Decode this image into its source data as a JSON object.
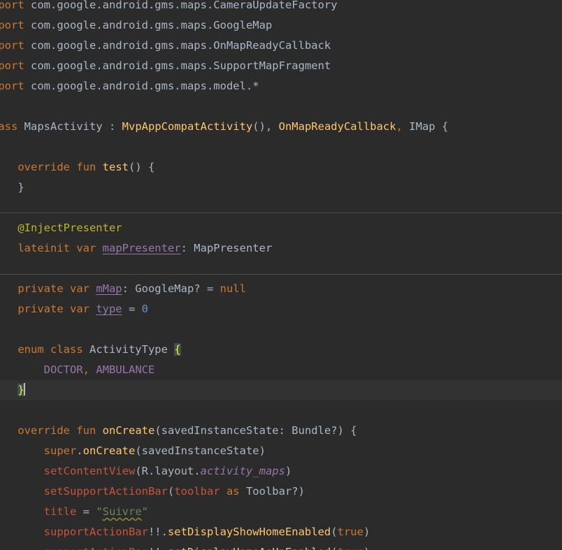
{
  "lines": [
    {
      "tokens": [
        {
          "t": "kw",
          "v": "nport"
        },
        {
          "t": "plain",
          "v": " com.google.android.gms.maps.CameraUpdateFactory"
        }
      ]
    },
    {
      "tokens": [
        {
          "t": "kw",
          "v": "nport"
        },
        {
          "t": "plain",
          "v": " com.google.android.gms.maps.GoogleMap"
        }
      ]
    },
    {
      "tokens": [
        {
          "t": "kw",
          "v": "nport"
        },
        {
          "t": "plain",
          "v": " com.google.android.gms.maps.OnMapReadyCallback"
        }
      ]
    },
    {
      "tokens": [
        {
          "t": "kw",
          "v": "nport"
        },
        {
          "t": "plain",
          "v": " com.google.android.gms.maps.SupportMapFragment"
        }
      ]
    },
    {
      "tokens": [
        {
          "t": "kw",
          "v": "nport"
        },
        {
          "t": "plain",
          "v": " com.google.android.gms.maps.model.*"
        }
      ]
    },
    {
      "tokens": []
    },
    {
      "tokens": [
        {
          "t": "kw",
          "v": "lass "
        },
        {
          "t": "plain",
          "v": "MapsActivity : "
        },
        {
          "t": "fn",
          "v": "MvpAppCompatActivity"
        },
        {
          "t": "plain",
          "v": "(), "
        },
        {
          "t": "fn",
          "v": "OnMapReadyCallback"
        },
        {
          "t": "kw",
          "v": ", "
        },
        {
          "t": "plain",
          "v": "IMap {"
        }
      ]
    },
    {
      "tokens": []
    },
    {
      "tokens": [
        {
          "t": "plain",
          "v": "    "
        },
        {
          "t": "kw",
          "v": "override fun "
        },
        {
          "t": "fn",
          "v": "test"
        },
        {
          "t": "plain",
          "v": "() {"
        }
      ]
    },
    {
      "tokens": [
        {
          "t": "plain",
          "v": "    }"
        }
      ]
    },
    {
      "tokens": []
    },
    {
      "tokens": [
        {
          "t": "plain",
          "v": "    "
        },
        {
          "t": "ann",
          "v": "@InjectPresenter"
        }
      ]
    },
    {
      "tokens": [
        {
          "t": "plain",
          "v": "    "
        },
        {
          "t": "kw",
          "v": "lateinit var "
        },
        {
          "t": "prop-u",
          "v": "mapPresenter"
        },
        {
          "t": "plain",
          "v": ": MapPresenter"
        }
      ]
    },
    {
      "tokens": []
    },
    {
      "tokens": [
        {
          "t": "plain",
          "v": "    "
        },
        {
          "t": "kw",
          "v": "private var "
        },
        {
          "t": "prop-u",
          "v": "mMap"
        },
        {
          "t": "plain",
          "v": ": GoogleMap? = "
        },
        {
          "t": "kw",
          "v": "null"
        }
      ]
    },
    {
      "tokens": [
        {
          "t": "plain",
          "v": "    "
        },
        {
          "t": "kw",
          "v": "private var "
        },
        {
          "t": "prop-u",
          "v": "type"
        },
        {
          "t": "plain",
          "v": " = "
        },
        {
          "t": "num",
          "v": "0"
        }
      ]
    },
    {
      "tokens": []
    },
    {
      "tokens": [
        {
          "t": "plain",
          "v": "    "
        },
        {
          "t": "kw",
          "v": "enum class "
        },
        {
          "t": "plain",
          "v": "ActivityType "
        },
        {
          "t": "brace-hl",
          "v": "{"
        }
      ]
    },
    {
      "tokens": [
        {
          "t": "plain",
          "v": "        "
        },
        {
          "t": "enumc",
          "v": "DOCTOR"
        },
        {
          "t": "kw",
          "v": ", "
        },
        {
          "t": "enumc",
          "v": "AMBULANCE"
        }
      ]
    },
    {
      "tokens": [
        {
          "t": "plain",
          "v": "    "
        },
        {
          "t": "brace-hl2",
          "v": "}"
        }
      ],
      "current": true
    },
    {
      "tokens": []
    },
    {
      "tokens": [
        {
          "t": "plain",
          "v": "    "
        },
        {
          "t": "kw",
          "v": "override fun "
        },
        {
          "t": "fn",
          "v": "onCreate"
        },
        {
          "t": "plain",
          "v": "(savedInstanceState: Bundle?) {"
        }
      ]
    },
    {
      "tokens": [
        {
          "t": "plain",
          "v": "        "
        },
        {
          "t": "kw",
          "v": "super"
        },
        {
          "t": "plain",
          "v": "."
        },
        {
          "t": "fn",
          "v": "onCreate"
        },
        {
          "t": "plain",
          "v": "(savedInstanceState)"
        }
      ]
    },
    {
      "tokens": [
        {
          "t": "plain",
          "v": "        "
        },
        {
          "t": "syn",
          "v": "setContentView"
        },
        {
          "t": "plain",
          "v": "(R.layout."
        },
        {
          "t": "ital",
          "v": "activity_maps"
        },
        {
          "t": "plain",
          "v": ")"
        }
      ]
    },
    {
      "tokens": [
        {
          "t": "plain",
          "v": "        "
        },
        {
          "t": "syn",
          "v": "setSupportActionBar"
        },
        {
          "t": "plain",
          "v": "("
        },
        {
          "t": "syn",
          "v": "toolbar"
        },
        {
          "t": "kw",
          "v": " as "
        },
        {
          "t": "plain",
          "v": "Toolbar?)"
        }
      ]
    },
    {
      "tokens": [
        {
          "t": "plain",
          "v": "        "
        },
        {
          "t": "syn",
          "v": "title"
        },
        {
          "t": "plain",
          "v": " = "
        },
        {
          "t": "str",
          "v": "\""
        },
        {
          "t": "str-warn",
          "v": "Suivre"
        },
        {
          "t": "str",
          "v": "\""
        }
      ]
    },
    {
      "tokens": [
        {
          "t": "plain",
          "v": "        "
        },
        {
          "t": "syn",
          "v": "supportActionBar"
        },
        {
          "t": "plain",
          "v": "!!."
        },
        {
          "t": "fn",
          "v": "setDisplayShowHomeEnabled"
        },
        {
          "t": "plain",
          "v": "("
        },
        {
          "t": "kw",
          "v": "true"
        },
        {
          "t": "plain",
          "v": ")"
        }
      ]
    },
    {
      "tokens": [
        {
          "t": "plain",
          "v": "        "
        },
        {
          "t": "syn",
          "v": "supportActionBar"
        },
        {
          "t": "plain",
          "v": "!!."
        },
        {
          "t": "fn",
          "v": "setDisplayHomeAsUpEnabled"
        },
        {
          "t": "plain",
          "v": "("
        },
        {
          "t": "kw",
          "v": "true"
        },
        {
          "t": "plain",
          "v": ")"
        }
      ]
    }
  ]
}
